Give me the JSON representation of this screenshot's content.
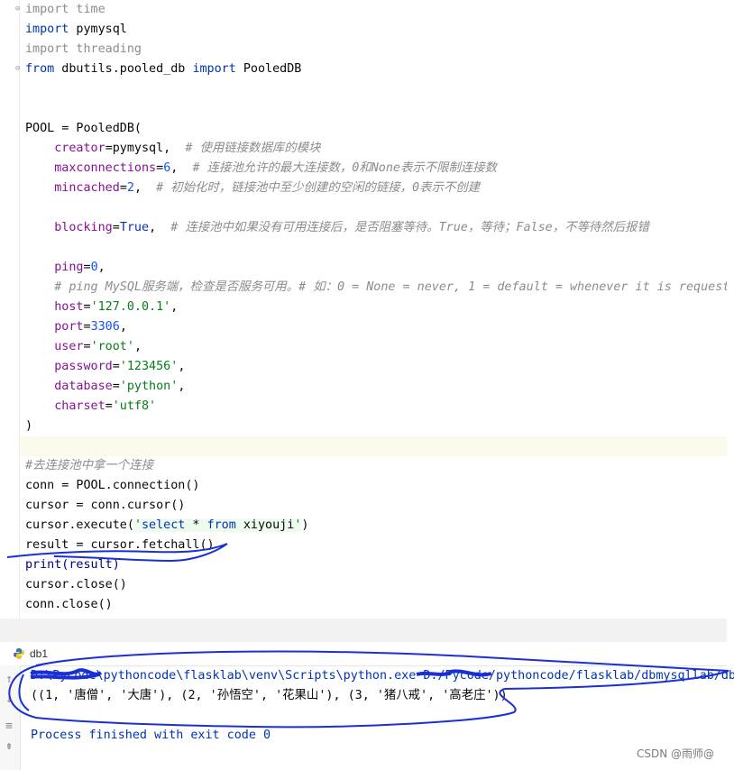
{
  "editor": {
    "lines": {
      "l1": {
        "kw": "import",
        "rest": " time"
      },
      "l2": {
        "kw": "import",
        "rest": " pymysql"
      },
      "l3": {
        "kw": "import",
        "rest": " threading"
      },
      "l4": {
        "kw1": "from",
        "mod": " dbutils.pooled_db ",
        "kw2": "import",
        "rest": " PooledDB"
      },
      "pool_open": "POOL = PooledDB(",
      "creator": {
        "param": "creator",
        "val": "=pymysql,",
        "cmt": "# 使用链接数据库的模块"
      },
      "maxconn": {
        "param": "maxconnections",
        "eq": "=",
        "num": "6",
        "comma": ",",
        "cmt": "# 连接池允许的最大连接数，0和None表示不限制连接数"
      },
      "mincached": {
        "param": "mincached",
        "eq": "=",
        "num": "2",
        "comma": ",",
        "cmt": "# 初始化时，链接池中至少创建的空闲的链接，0表示不创建"
      },
      "blocking": {
        "param": "blocking",
        "eq": "=",
        "kw": "True",
        "comma": ",",
        "cmt": "# 连接池中如果没有可用连接后，是否阻塞等待。True，等待；False，不等待然后报错"
      },
      "ping": {
        "param": "ping",
        "eq": "=",
        "num": "0",
        "comma": ","
      },
      "ping_cmt": "# ping MySQL服务端，检查是否服务可用。# 如：0 = None = never, 1 = default = whenever it is requeste",
      "host": {
        "param": "host",
        "eq": "=",
        "str": "'127.0.0.1'",
        "comma": ","
      },
      "port": {
        "param": "port",
        "eq": "=",
        "num": "3306",
        "comma": ","
      },
      "user": {
        "param": "user",
        "eq": "=",
        "str": "'root'",
        "comma": ","
      },
      "password": {
        "param": "password",
        "eq": "=",
        "str": "'123456'",
        "comma": ","
      },
      "database": {
        "param": "database",
        "eq": "=",
        "str": "'python'",
        "comma": ","
      },
      "charset": {
        "param": "charset",
        "eq": "=",
        "str": "'utf8'"
      },
      "pool_close": ")",
      "cmt_conn": "#去连接池中拿一个连接",
      "conn": "conn = POOL.connection()",
      "cursor": "cursor = conn.cursor()",
      "exec": {
        "pre": "cursor.execute(",
        "q1": "'",
        "sel": "select",
        "mid": " * ",
        "from": "from",
        "tbl": " xiyouji",
        "q2": "'",
        "post": ")"
      },
      "result": "result = cursor.fetchall()",
      "print": "print(result)",
      "cclose": "cursor.close()",
      "connclose": "conn.close()"
    }
  },
  "run": {
    "tab_label": "db1",
    "cmd": "D:\\Pycode\\pythoncode\\flasklab\\venv\\Scripts\\python.exe D:/Pycode/pythoncode/flasklab/dbmysqllab/db",
    "result": "((1, '唐僧', '大唐'), (2, '孙悟空', '花果山'), (3, '猪八戒', '高老庄'))",
    "exit": "Process finished with exit code 0"
  },
  "watermark": "CSDN @雨师@",
  "colors": {
    "annotation_ink": "#1a2fd6",
    "keyword": "#0033b3",
    "string": "#067d17",
    "param": "#871094"
  }
}
